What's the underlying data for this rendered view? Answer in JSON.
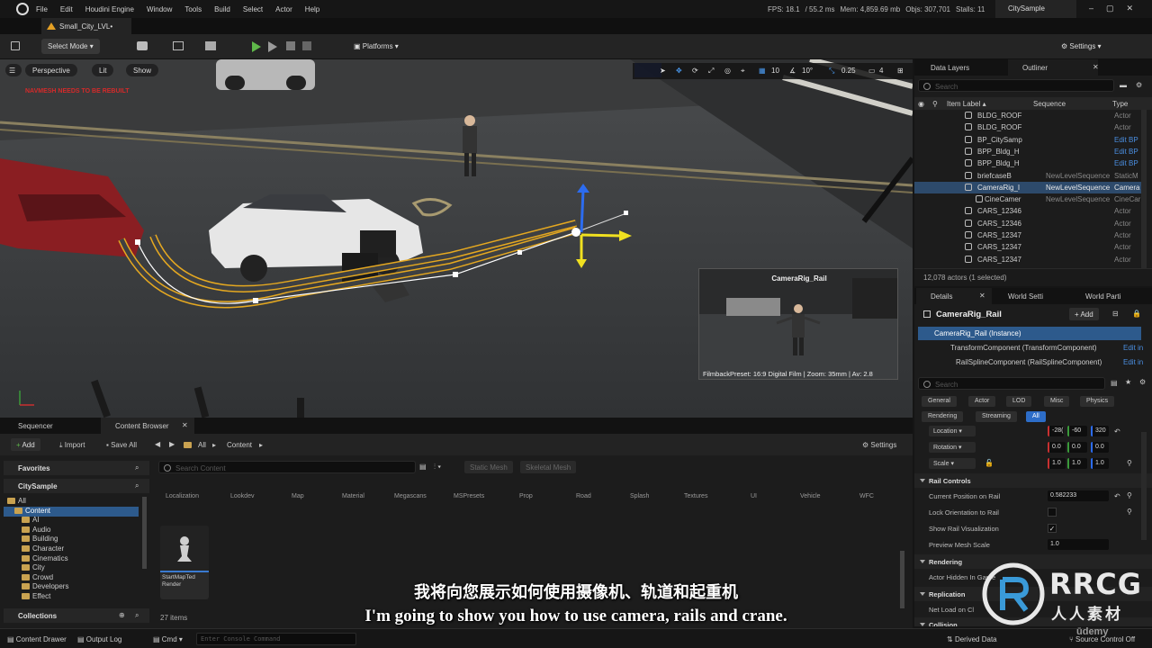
{
  "menubar": {
    "items": [
      "File",
      "Edit",
      "Houdini Engine",
      "Window",
      "Tools",
      "Build",
      "Select",
      "Actor",
      "Help"
    ],
    "stats": {
      "fps": "FPS: 18.1",
      "ms": "/ 55.2 ms",
      "mem": "Mem: 4,859.69 mb",
      "objs": "Objs: 307,701",
      "stalls": "Stalls: 11"
    },
    "project": "CitySample"
  },
  "level_tab": "Small_City_LVL•",
  "toolbar": {
    "select_mode": "Select Mode",
    "platforms": "Platforms",
    "settings": "Settings"
  },
  "viewport": {
    "perspective": "Perspective",
    "lit": "Lit",
    "show": "Show",
    "warning": "NAVMESH NEEDS TO BE REBUILT",
    "grid": "10",
    "angle": "10°",
    "speed": "0.25",
    "cam": "4",
    "pip_title": "CameraRig_Rail",
    "pip_caption": "FilmbackPreset: 16:9 Digital Film | Zoom: 35mm | Av: 2.8"
  },
  "outliner": {
    "tab_layers": "Data Layers",
    "tab_outliner": "Outliner",
    "search_placeholder": "Search",
    "col_label": "Item Label ▴",
    "col_sequence": "Sequence",
    "col_type": "Type",
    "rows": [
      {
        "name": "BLDG_ROOF",
        "seq": "",
        "type": "Actor",
        "link": false,
        "sel": false
      },
      {
        "name": "BLDG_ROOF",
        "seq": "",
        "type": "Actor",
        "link": false,
        "sel": false
      },
      {
        "name": "BP_CitySamp",
        "seq": "",
        "type": "Edit BP",
        "link": true,
        "sel": false
      },
      {
        "name": "BPP_Bldg_H",
        "seq": "",
        "type": "Edit BP",
        "link": true,
        "sel": false
      },
      {
        "name": "BPP_Bldg_H",
        "seq": "",
        "type": "Edit BP",
        "link": true,
        "sel": false
      },
      {
        "name": "briefcaseB",
        "seq": "NewLevelSequence",
        "type": "StaticM",
        "link": false,
        "sel": false
      },
      {
        "name": "CameraRig_I",
        "seq": "NewLevelSequence",
        "type": "Camera",
        "link": false,
        "sel": true
      },
      {
        "name": "CineCamer",
        "seq": "NewLevelSequence",
        "type": "CineCar",
        "link": false,
        "sel": false
      },
      {
        "name": "CARS_12346",
        "seq": "",
        "type": "Actor",
        "link": false,
        "sel": false
      },
      {
        "name": "CARS_12346",
        "seq": "",
        "type": "Actor",
        "link": false,
        "sel": false
      },
      {
        "name": "CARS_12347",
        "seq": "",
        "type": "Actor",
        "link": false,
        "sel": false
      },
      {
        "name": "CARS_12347",
        "seq": "",
        "type": "Actor",
        "link": false,
        "sel": false
      },
      {
        "name": "CARS_12347",
        "seq": "",
        "type": "Actor",
        "link": false,
        "sel": false
      }
    ],
    "footer": "12,078 actors (1 selected)"
  },
  "details": {
    "tabs": [
      "Details",
      "World Setti",
      "World Parti"
    ],
    "actor": "CameraRig_Rail",
    "add": "+ Add",
    "components": [
      "CameraRig_Rail (Instance)",
      "TransformComponent (TransformComponent)",
      "RailSplineComponent (RailSplineComponent)"
    ],
    "edit_in": "Edit in",
    "search_placeholder": "Search",
    "filters": [
      "General",
      "Actor",
      "LOD",
      "Misc",
      "Physics",
      "Rendering",
      "Streaming",
      "All"
    ],
    "location": {
      "label": "Location",
      "x": "-28(",
      "y": "-60",
      "z": "320"
    },
    "rotation": {
      "label": "Rotation",
      "x": "0.0",
      "y": "0.0",
      "z": "0.0"
    },
    "scale": {
      "label": "Scale",
      "x": "1.0",
      "y": "1.0",
      "z": "1.0"
    },
    "rail_controls": "Rail Controls",
    "current_position_label": "Current Position on Rail",
    "current_position_value": "0.582233",
    "lock_orientation": "Lock Orientation to Rail",
    "show_rail_vis": "Show Rail Visualization",
    "preview_scale_label": "Preview Mesh Scale",
    "preview_scale_value": "1.0",
    "rendering": "Rendering",
    "actor_hidden": "Actor Hidden In Game",
    "replication": "Replication",
    "net_load": "Net Load on Cl",
    "collision": "Collision"
  },
  "bottom": {
    "tab_sequencer": "Sequencer",
    "tab_content": "Content Browser",
    "add": "Add",
    "import": "Import",
    "save_all": "Save All",
    "path": [
      "All",
      "Content"
    ],
    "settings": "Settings",
    "favorites": "Favorites",
    "citysample": "CitySample",
    "collections": "Collections",
    "search_placeholder": "Search Content",
    "chips": [
      "Static Mesh",
      "Skeletal Mesh"
    ],
    "categories": [
      "Localization",
      "Lookdev",
      "Map",
      "Material",
      "Megascans",
      "MSPresets",
      "Prop",
      "Road",
      "Splash",
      "Textures",
      "UI",
      "Vehicle",
      "WFC"
    ],
    "tree": [
      "All",
      "Content",
      "AI",
      "Audio",
      "Building",
      "Character",
      "Cinematics",
      "City",
      "Crowd",
      "Developers",
      "Effect"
    ],
    "asset_label": "StartMapTed Render",
    "count": "27 items"
  },
  "status": {
    "content_drawer": "Content Drawer",
    "output_log": "Output Log",
    "cmd": "Cmd",
    "console_placeholder": "Enter Console Command",
    "derived": "Derived Data",
    "source": "Source Control Off"
  },
  "subtitles": {
    "cn": "我将向您展示如何使用摄像机、轨道和起重机",
    "en": "I'm going to show you how to use camera, rails and crane."
  },
  "watermark": {
    "brand": "RRCG",
    "brand_cn": "人人素材",
    "udemy": "ūdemy"
  }
}
